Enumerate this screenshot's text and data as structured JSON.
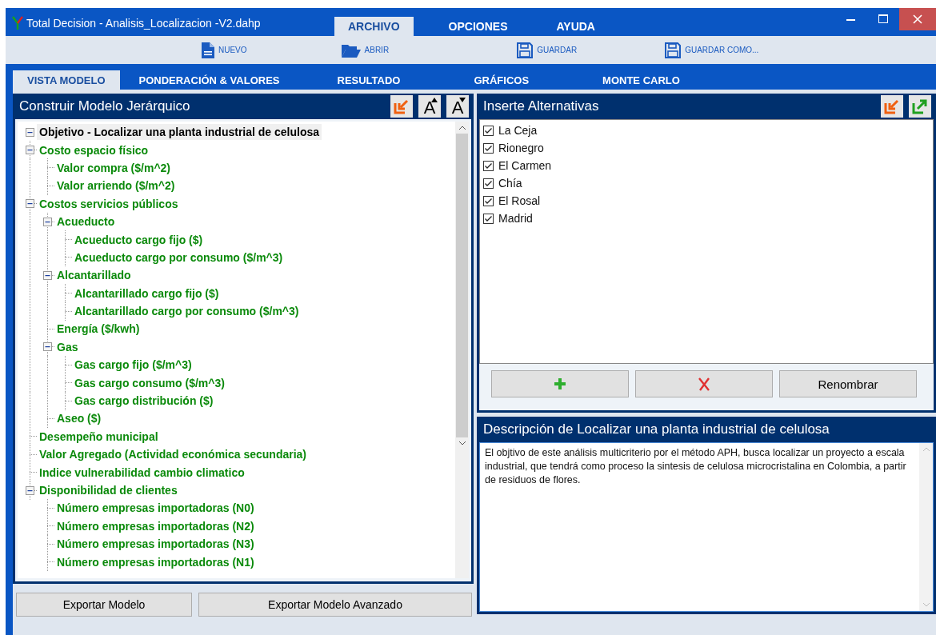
{
  "window": {
    "title": "Total Decision - Analisis_Localizacion -V2.dahp"
  },
  "menu": [
    {
      "label": "ARCHIVO",
      "selected": true
    },
    {
      "label": "OPCIONES",
      "selected": false
    },
    {
      "label": "AYUDA",
      "selected": false
    }
  ],
  "toolbar": [
    {
      "label": "NUEVO",
      "kind": "file"
    },
    {
      "label": "ABRIR",
      "kind": "folder"
    },
    {
      "label": "GUARDAR",
      "kind": "save"
    },
    {
      "label": "GUARDAR COMO...",
      "kind": "save"
    }
  ],
  "tabs": [
    {
      "label": "VISTA MODELO",
      "selected": true
    },
    {
      "label": "PONDERACIÓN & VALORES",
      "selected": false
    },
    {
      "label": "RESULTADO",
      "selected": false
    },
    {
      "label": "GRÁFICOS",
      "selected": false
    },
    {
      "label": "MONTE CARLO",
      "selected": false
    }
  ],
  "model_panel": {
    "title": "Construir Modelo Jerárquico",
    "font_buttons": [
      {
        "label": "A",
        "kind": "up"
      },
      {
        "label": "A",
        "kind": "down"
      }
    ],
    "tree": {
      "label": "Objetivo - Localizar una planta industrial de celulosa",
      "selected": true,
      "expanded": true,
      "children": [
        {
          "label": "Costo espacio físico",
          "selected": false,
          "expanded": true,
          "children": [
            {
              "label": "Valor compra ($/m^2)",
              "selected": false
            },
            {
              "label": "Valor arriendo ($/m^2)",
              "selected": false
            }
          ]
        },
        {
          "label": "Costos servicios públicos",
          "selected": false,
          "expanded": true,
          "children": [
            {
              "label": "Acueducto",
              "selected": false,
              "expanded": true,
              "children": [
                {
                  "label": "Acueducto cargo fijo ($)",
                  "selected": false
                },
                {
                  "label": "Acueducto cargo por consumo ($/m^3)",
                  "selected": false
                }
              ]
            },
            {
              "label": "Alcantarillado",
              "selected": false,
              "expanded": true,
              "children": [
                {
                  "label": "Alcantarillado cargo fijo ($)",
                  "selected": false
                },
                {
                  "label": "Alcantarillado cargo por consumo ($/m^3)",
                  "selected": false
                }
              ]
            },
            {
              "label": "Energía ($/kwh)",
              "selected": false
            },
            {
              "label": "Gas",
              "selected": false,
              "expanded": true,
              "children": [
                {
                  "label": "Gas cargo fijo ($/m^3)",
                  "selected": false
                },
                {
                  "label": "Gas cargo consumo ($/m^3)",
                  "selected": false
                },
                {
                  "label": "Gas cargo distribución ($)",
                  "selected": false
                }
              ]
            },
            {
              "label": "Aseo ($)",
              "selected": false
            }
          ]
        },
        {
          "label": "Desempeño municipal",
          "selected": false
        },
        {
          "label": "Valor Agregado (Actividad económica secundaria)",
          "selected": false
        },
        {
          "label": "Indice vulnerabilidad cambio climatico",
          "selected": false
        },
        {
          "label": "Disponibilidad de clientes",
          "selected": false,
          "expanded": true,
          "children": [
            {
              "label": "Número empresas importadoras (N0)",
              "selected": false
            },
            {
              "label": "Número empresas importadoras (N2)",
              "selected": false
            },
            {
              "label": "Número empresas importadoras (N3)",
              "selected": false
            },
            {
              "label": "Número empresas importadoras (N1)",
              "selected": false
            }
          ]
        }
      ]
    },
    "buttons": [
      "Exportar Modelo",
      "Exportar Modelo Avanzado"
    ]
  },
  "alternatives_panel": {
    "title": "Inserte Alternativas",
    "items": [
      {
        "label": "La Ceja",
        "checked": true
      },
      {
        "label": "Rionegro",
        "checked": true
      },
      {
        "label": "El Carmen",
        "checked": true
      },
      {
        "label": "Chía",
        "checked": true
      },
      {
        "label": "El Rosal",
        "checked": true
      },
      {
        "label": "Madrid",
        "checked": true
      }
    ],
    "rename_button": "Renombrar"
  },
  "description_panel": {
    "title": "Descripción de Localizar una planta industrial de celulosa",
    "text": "El objtivo de este análisis multicriterio por el método APH, busca localizar un proyecto a escala industrial, que tendrá como proceso la sintesis de celulosa microcristalina en Colombia, a partir de residuos de flores."
  }
}
